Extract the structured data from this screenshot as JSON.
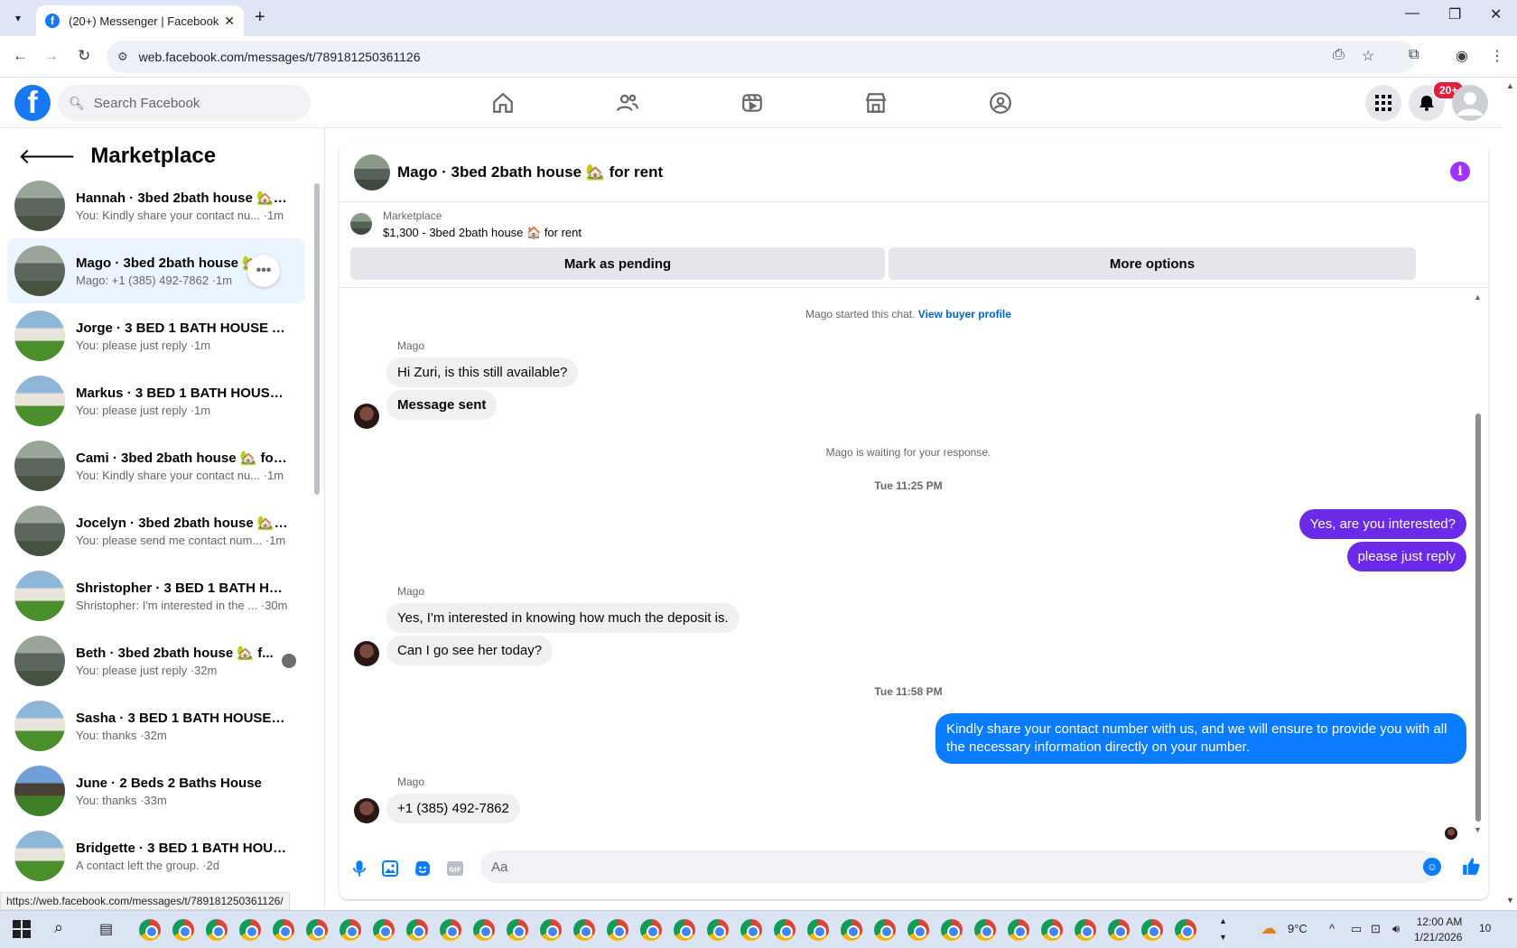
{
  "browser": {
    "tab_title": "(20+) Messenger | Facebook",
    "url": "web.facebook.com/messages/t/789181250361126",
    "status_url": "https://web.facebook.com/messages/t/789181250361126/"
  },
  "header": {
    "search_placeholder": "Search Facebook",
    "notification_badge": "20+",
    "nav_icons": [
      "home-icon",
      "friends-icon",
      "video-icon",
      "marketplace-icon",
      "groups-icon"
    ]
  },
  "sidebar": {
    "title": "Marketplace",
    "conversations": [
      {
        "name": "Hannah · 3bed 2bath house 🏡 f...",
        "snippet": "You: Kindly share your contact nu... ·1m"
      },
      {
        "name": "Mago · 3bed 2bath house 🏡 f...",
        "snippet": "Mago: +1 (385) 492-7862 ·1m"
      },
      {
        "name": "Jorge · 3 BED 1 BATH HOUSE AV...",
        "snippet": "You: please just reply ·1m"
      },
      {
        "name": "Markus · 3 BED 1 BATH HOUSE A...",
        "snippet": "You: please just reply ·1m"
      },
      {
        "name": "Cami · 3bed 2bath house 🏡 for ...",
        "snippet": "You: Kindly share your contact nu... ·1m"
      },
      {
        "name": "Jocelyn · 3bed 2bath house 🏡 f...",
        "snippet": "You: please send me contact num... ·1m"
      },
      {
        "name": "Shristopher · 3 BED 1 BATH HOU...",
        "snippet": "Shristopher: I'm interested in the ... ·30m"
      },
      {
        "name": "Beth · 3bed 2bath house 🏡 f...",
        "snippet": "You: please just reply ·32m"
      },
      {
        "name": "Sasha · 3 BED 1 BATH HOUSE AV...",
        "snippet": "You: thanks ·32m"
      },
      {
        "name": "June · 2 Beds 2 Baths House",
        "snippet": "You: thanks ·33m"
      },
      {
        "name": "Bridgette · 3 BED 1 BATH HOUSE...",
        "snippet": "A contact left the group. ·2d"
      }
    ]
  },
  "chat": {
    "title": "Mago · 3bed 2bath house 🏡 for rent",
    "listing_label": "Marketplace",
    "listing_title": "$1,300 - 3bed 2bath house 🏠 for rent",
    "mark_pending": "Mark as pending",
    "more_options": "More options",
    "started_text": "Mago started this chat.",
    "view_profile": "View buyer profile",
    "sender1": "Mago",
    "msg1": "Hi Zuri, is this still available?",
    "msg2": "Message sent",
    "waiting": "Mago is waiting for your response.",
    "ts1": "Tue 11:25 PM",
    "out1": "Yes, are you interested?",
    "out2": "please just reply",
    "sender2": "Mago",
    "msg3": "Yes, I'm interested in knowing how much the deposit is.",
    "msg4": "Can I go see her today?",
    "ts2": "Tue 11:58 PM",
    "out3": "Kindly share your contact number with us, and we will ensure to provide you with all the necessary information directly on your number.",
    "sender3": "Mago",
    "msg5": "+1 (385) 492-7862",
    "composer_placeholder": "Aa"
  },
  "taskbar": {
    "temp": "9°C",
    "time": "12:00 AM",
    "date": "1/21/2026",
    "notif_count": "10"
  },
  "colors": {
    "fb_blue": "#1877f2",
    "out_bubble": "#0a7cff",
    "out_bubble_purple": "#6a2ae8",
    "info": "#a033ff"
  }
}
